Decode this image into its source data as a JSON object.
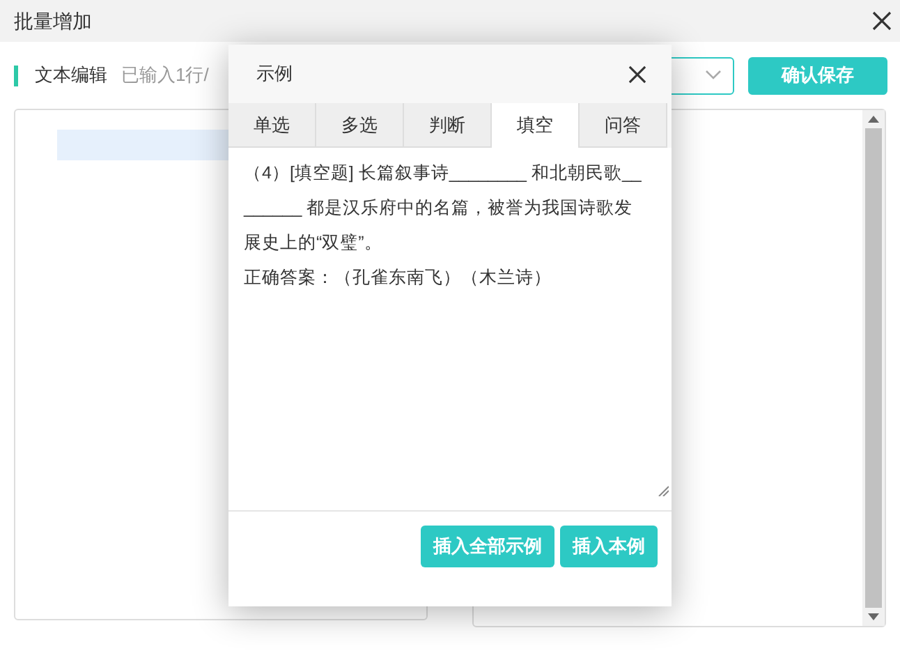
{
  "window": {
    "title": "批量增加"
  },
  "toolbar": {
    "section_title": "文本编辑",
    "input_status": "已输入1行/",
    "save_button": "确认保存"
  },
  "dialog": {
    "title": "示例",
    "tabs": [
      {
        "label": "单选",
        "selected": false
      },
      {
        "label": "多选",
        "selected": false
      },
      {
        "label": "判断",
        "selected": false
      },
      {
        "label": "填空",
        "selected": true
      },
      {
        "label": "问答",
        "selected": false
      }
    ],
    "example_lines": [
      "（4）[填空题] 长篇叙事诗________ 和北朝民歌________ 都是汉乐府中的名篇，被誉为我国诗歌发展史上的“双璧”。",
      "正确答案：（孔雀东南飞）（木兰诗）"
    ],
    "buttons": [
      "插入全部示例",
      "插入本例"
    ]
  }
}
